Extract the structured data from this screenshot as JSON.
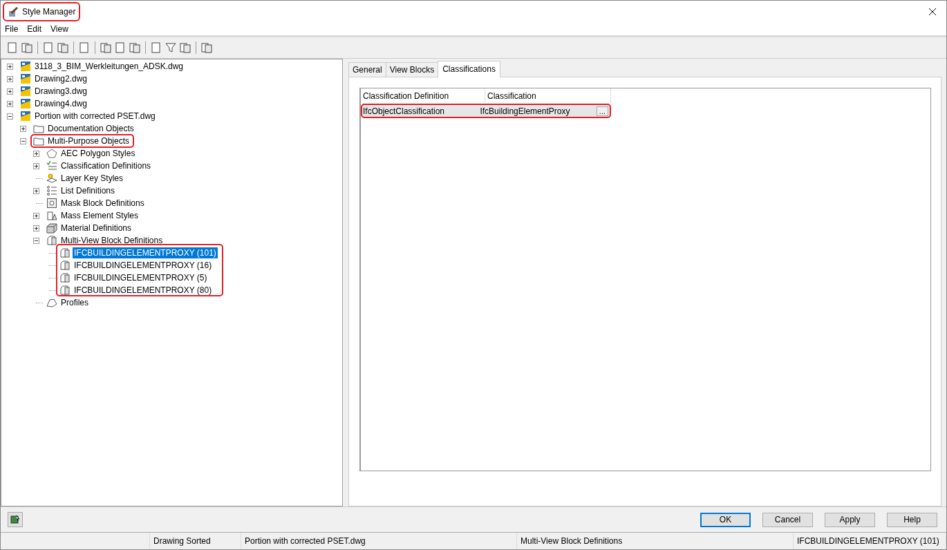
{
  "window": {
    "title": "Style Manager",
    "highlighted": true
  },
  "menu": [
    "File",
    "Edit",
    "View"
  ],
  "tree": [
    {
      "label": "3118_3_BIM_Werkleitungen_ADSK.dwg",
      "kind": "drawing",
      "expanded": false,
      "selected": false
    },
    {
      "label": "Drawing2.dwg",
      "kind": "drawing",
      "expanded": false,
      "selected": false
    },
    {
      "label": "Drawing3.dwg",
      "kind": "drawing",
      "expanded": false,
      "selected": false
    },
    {
      "label": "Drawing4.dwg",
      "kind": "drawing",
      "expanded": false,
      "selected": false
    },
    {
      "label": "Portion with corrected PSET.dwg",
      "kind": "drawing",
      "expanded": true,
      "selected": false,
      "children": [
        {
          "label": "Documentation Objects",
          "kind": "folder",
          "expanded": false,
          "selected": false
        },
        {
          "label": "Multi-Purpose Objects",
          "kind": "folder",
          "expanded": true,
          "selected": false,
          "highlighted": true,
          "children": [
            {
              "label": "AEC Polygon Styles",
              "kind": "polygon",
              "expanded": false,
              "selected": false
            },
            {
              "label": "Classification Definitions",
              "kind": "classification",
              "expanded": false,
              "selected": false
            },
            {
              "label": "Layer Key Styles",
              "kind": "layerkey",
              "selected": false
            },
            {
              "label": "List Definitions",
              "kind": "list",
              "expanded": false,
              "selected": false
            },
            {
              "label": "Mask Block Definitions",
              "kind": "mask",
              "selected": false
            },
            {
              "label": "Mass Element Styles",
              "kind": "mass",
              "expanded": false,
              "selected": false
            },
            {
              "label": "Material Definitions",
              "kind": "material",
              "expanded": false,
              "selected": false
            },
            {
              "label": "Multi-View Block Definitions",
              "kind": "mvblock",
              "expanded": true,
              "selected": false,
              "children_highlighted": true,
              "children": [
                {
                  "label": "IFCBUILDINGELEMENTPROXY (101)",
                  "kind": "mvblock",
                  "selected": true
                },
                {
                  "label": "IFCBUILDINGELEMENTPROXY (16)",
                  "kind": "mvblock",
                  "selected": false
                },
                {
                  "label": "IFCBUILDINGELEMENTPROXY (5)",
                  "kind": "mvblock",
                  "selected": false
                },
                {
                  "label": "IFCBUILDINGELEMENTPROXY (80)",
                  "kind": "mvblock",
                  "selected": false
                }
              ]
            },
            {
              "label": "Profiles",
              "kind": "profile",
              "selected": false
            }
          ]
        }
      ]
    }
  ],
  "tabs": [
    {
      "label": "General",
      "selected": false
    },
    {
      "label": "View Blocks",
      "selected": false
    },
    {
      "label": "Classifications",
      "selected": true
    }
  ],
  "table": {
    "columns": [
      "Classification Definition",
      "Classification"
    ],
    "rows": [
      {
        "cells": [
          "IfcObjectClassification",
          "IfcBuildingElementProxy"
        ],
        "button": "...",
        "highlighted": true
      }
    ]
  },
  "buttons": [
    {
      "label": "OK",
      "default": true
    },
    {
      "label": "Cancel",
      "default": false
    },
    {
      "label": "Apply",
      "default": false
    },
    {
      "label": "Help",
      "default": false
    }
  ],
  "status_bar": [
    "Drawing Sorted",
    "Portion with corrected PSET.dwg",
    "Multi-View Block Definitions",
    "IFCBUILDINGELEMENTPROXY (101)"
  ]
}
